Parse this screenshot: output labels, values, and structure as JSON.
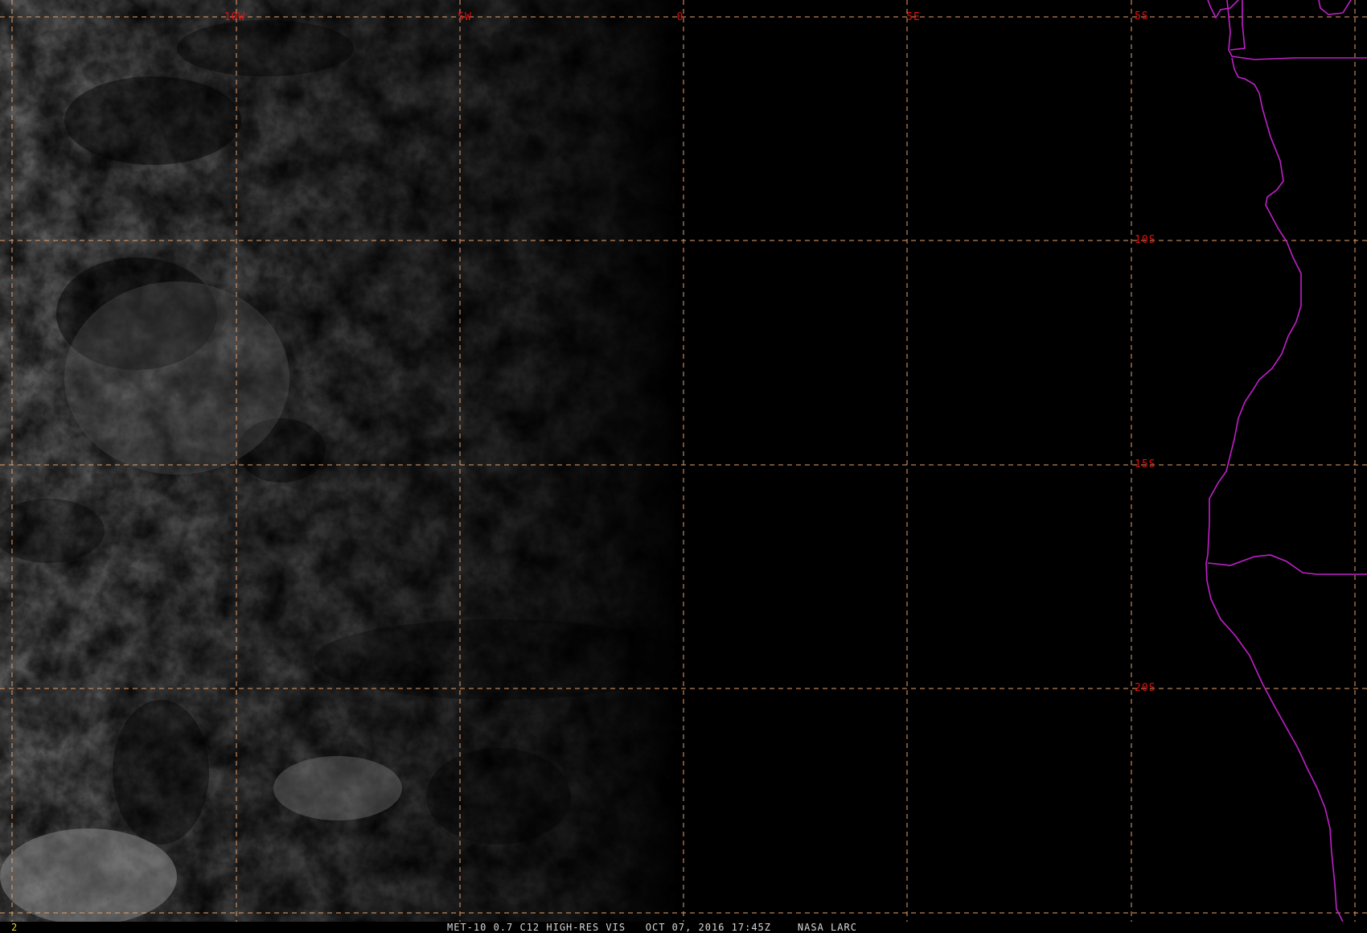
{
  "map": {
    "lon_labels": [
      "10W",
      "5W",
      "0",
      "5E"
    ],
    "lat_labels": [
      "5S",
      "10S",
      "15S",
      "20S"
    ],
    "colors": {
      "grid": "#e8a06a",
      "grid_label": "#e01010",
      "coastline": "#c020c8",
      "frame_number": "#e0d040",
      "caption": "#d8d8d8",
      "night_side": "#000000"
    }
  },
  "status_bar": {
    "frame_number": "2",
    "caption": "MET-10 0.7 C12 HIGH-RES VIS   OCT 07, 2016 17:45Z    NASA LARC"
  }
}
